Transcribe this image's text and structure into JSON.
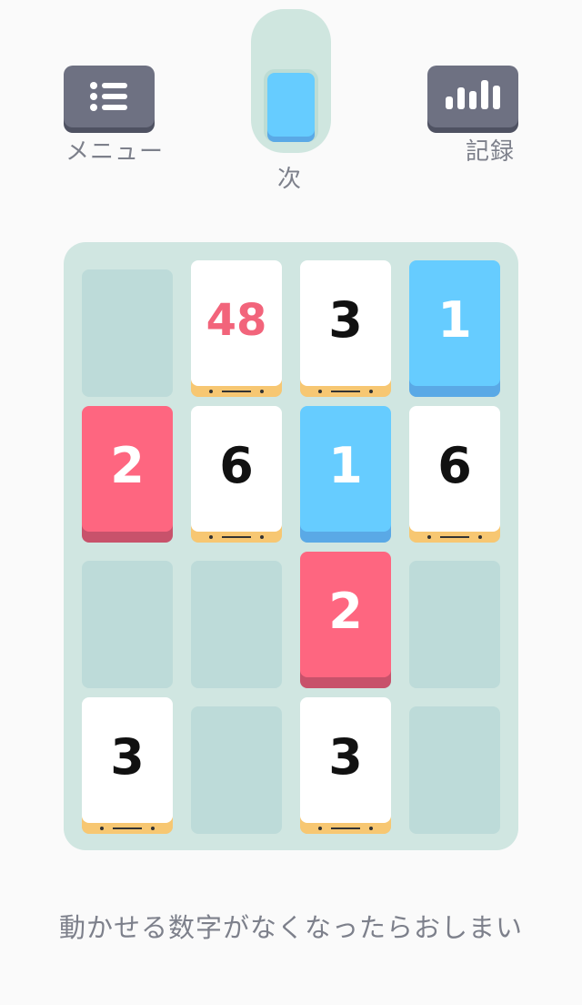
{
  "top": {
    "menu_label": "メニュー",
    "next_label": "次",
    "records_label": "記録"
  },
  "next_card": {
    "color": "blue"
  },
  "board": {
    "rows": [
      [
        null,
        48,
        3,
        1
      ],
      [
        2,
        6,
        1,
        6
      ],
      [
        null,
        null,
        2,
        null
      ],
      [
        3,
        null,
        3,
        null
      ]
    ]
  },
  "status_message": "動かせる数字がなくなったらおしまい",
  "colors": {
    "background": "#fafafa",
    "board": "#d0e6e1",
    "slot": "#bddbd9",
    "blue": "#66ccff",
    "red": "#fe6680",
    "white": "#ffffff",
    "accent_text": "#f2647b",
    "gold_edge": "#f7c772"
  }
}
